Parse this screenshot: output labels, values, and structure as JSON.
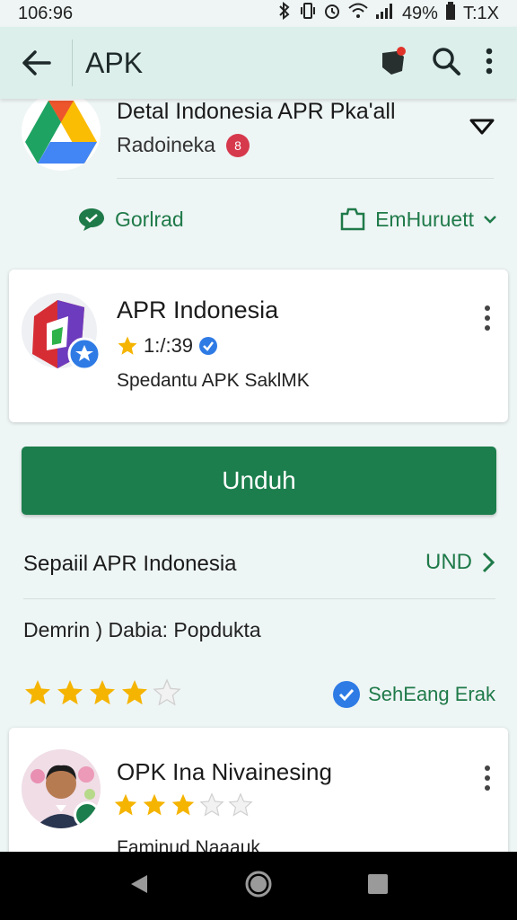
{
  "status_bar": {
    "time": "106:96",
    "battery": "49%",
    "extra": "T:1X"
  },
  "app_bar": {
    "title": "APK"
  },
  "top_app": {
    "name": "Detal Indonesia APR Pka'all",
    "developer": "Radoineka",
    "badge": "8"
  },
  "links": {
    "left_label": "Gorlrad",
    "right_label": "EmHuruett"
  },
  "card": {
    "app_name": "APR Indonesia",
    "rating": "1:/:39",
    "subtitle": "Spedantu APK SaklMK"
  },
  "download": {
    "label": "Unduh"
  },
  "section": {
    "title": "Sepaiil APR Indonesia",
    "link_label": "UND"
  },
  "info": {
    "line": "Demrin ) Dabia: Popdukta"
  },
  "stars_row": {
    "rating_value": 4,
    "max": 5,
    "verified_label": "SehEang Erak"
  },
  "card2": {
    "name": "OPK Ina Nivainesing",
    "rating_value": 3,
    "max": 5,
    "extra": "Faminud Naaauk"
  },
  "colors": {
    "accent_green": "#1b7e4c",
    "app_bar_bg": "#dcefea",
    "star_gold": "#f5b400",
    "verified_blue": "#2f7be5"
  }
}
